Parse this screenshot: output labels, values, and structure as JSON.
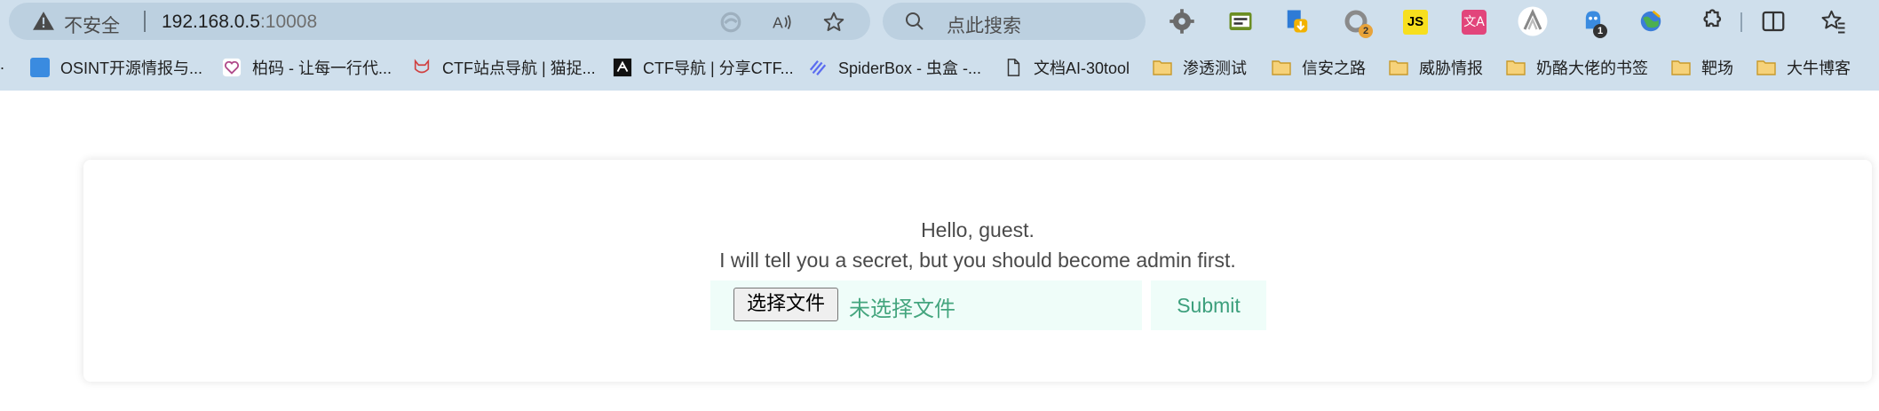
{
  "browser": {
    "address": {
      "insecure_label": "不安全",
      "host": "192.168.0.5",
      "port": ":10008"
    },
    "search": {
      "placeholder": "点此搜索"
    },
    "extensions": [
      {
        "name": "gear-extension-icon"
      },
      {
        "name": "mail-extension-icon"
      },
      {
        "name": "download-extension-icon"
      },
      {
        "name": "color-extension-icon",
        "badge": "2"
      },
      {
        "name": "js-extension-icon",
        "label": "JS"
      },
      {
        "name": "translate-extension-icon",
        "label": "文A"
      },
      {
        "name": "profile-avatar-icon"
      },
      {
        "name": "ghost-extension-icon",
        "badge": "1"
      },
      {
        "name": "globe-extension-icon"
      },
      {
        "name": "extensions-puzzle-icon"
      },
      {
        "name": "split-screen-icon"
      },
      {
        "name": "favorites-icon"
      }
    ],
    "bookmarks": [
      {
        "label": "OSINT开源情报与...",
        "icon": "blue-square-icon"
      },
      {
        "label": "柏码 - 让每一行代...",
        "icon": "heart-icon"
      },
      {
        "label": "CTF站点导航 | 猫捉...",
        "icon": "cat-icon"
      },
      {
        "label": "CTF导航 | 分享CTF...",
        "icon": "flag-icon"
      },
      {
        "label": "SpiderBox - 虫盒 -...",
        "icon": "spider-icon"
      },
      {
        "label": "文档AI-30tool",
        "icon": "document-icon"
      },
      {
        "label": "渗透测试",
        "icon": "folder-icon"
      },
      {
        "label": "信安之路",
        "icon": "folder-icon"
      },
      {
        "label": "威胁情报",
        "icon": "folder-icon"
      },
      {
        "label": "奶酪大佬的书签",
        "icon": "folder-icon"
      },
      {
        "label": "靶场",
        "icon": "folder-icon"
      },
      {
        "label": "大牛博客",
        "icon": "folder-icon"
      }
    ]
  },
  "page": {
    "greeting": "Hello, guest.",
    "secret": "I will tell you a secret, but you should become admin first.",
    "choose_file_label": "选择文件",
    "file_status": "未选择文件",
    "submit_label": "Submit"
  },
  "colors": {
    "chrome_bg": "#cfdfec",
    "field_bg": "#effdf9",
    "accent_green": "#44a57e"
  }
}
